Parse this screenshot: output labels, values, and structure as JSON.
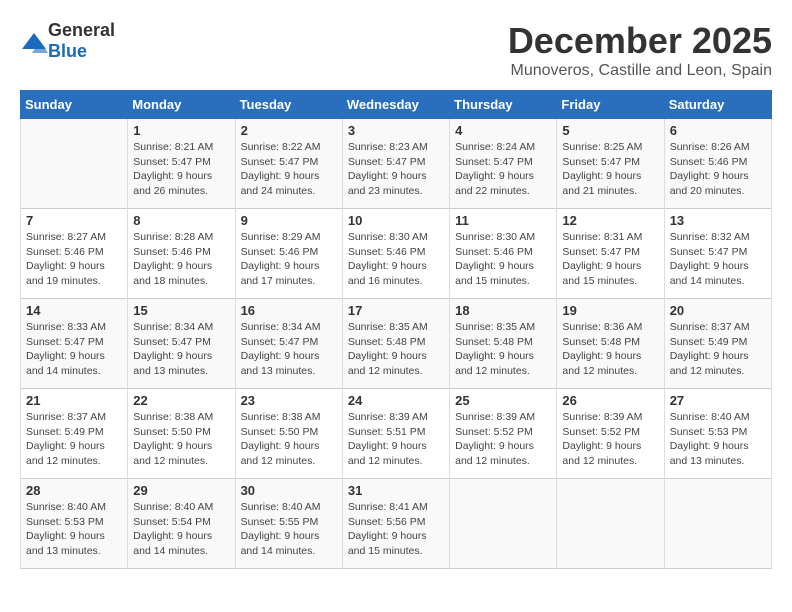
{
  "logo": {
    "general": "General",
    "blue": "Blue"
  },
  "title": "December 2025",
  "subtitle": "Munoveros, Castille and Leon, Spain",
  "days_of_week": [
    "Sunday",
    "Monday",
    "Tuesday",
    "Wednesday",
    "Thursday",
    "Friday",
    "Saturday"
  ],
  "weeks": [
    [
      {
        "num": "",
        "sunrise": "",
        "sunset": "",
        "daylight": ""
      },
      {
        "num": "1",
        "sunrise": "Sunrise: 8:21 AM",
        "sunset": "Sunset: 5:47 PM",
        "daylight": "Daylight: 9 hours and 26 minutes."
      },
      {
        "num": "2",
        "sunrise": "Sunrise: 8:22 AM",
        "sunset": "Sunset: 5:47 PM",
        "daylight": "Daylight: 9 hours and 24 minutes."
      },
      {
        "num": "3",
        "sunrise": "Sunrise: 8:23 AM",
        "sunset": "Sunset: 5:47 PM",
        "daylight": "Daylight: 9 hours and 23 minutes."
      },
      {
        "num": "4",
        "sunrise": "Sunrise: 8:24 AM",
        "sunset": "Sunset: 5:47 PM",
        "daylight": "Daylight: 9 hours and 22 minutes."
      },
      {
        "num": "5",
        "sunrise": "Sunrise: 8:25 AM",
        "sunset": "Sunset: 5:47 PM",
        "daylight": "Daylight: 9 hours and 21 minutes."
      },
      {
        "num": "6",
        "sunrise": "Sunrise: 8:26 AM",
        "sunset": "Sunset: 5:46 PM",
        "daylight": "Daylight: 9 hours and 20 minutes."
      }
    ],
    [
      {
        "num": "7",
        "sunrise": "Sunrise: 8:27 AM",
        "sunset": "Sunset: 5:46 PM",
        "daylight": "Daylight: 9 hours and 19 minutes."
      },
      {
        "num": "8",
        "sunrise": "Sunrise: 8:28 AM",
        "sunset": "Sunset: 5:46 PM",
        "daylight": "Daylight: 9 hours and 18 minutes."
      },
      {
        "num": "9",
        "sunrise": "Sunrise: 8:29 AM",
        "sunset": "Sunset: 5:46 PM",
        "daylight": "Daylight: 9 hours and 17 minutes."
      },
      {
        "num": "10",
        "sunrise": "Sunrise: 8:30 AM",
        "sunset": "Sunset: 5:46 PM",
        "daylight": "Daylight: 9 hours and 16 minutes."
      },
      {
        "num": "11",
        "sunrise": "Sunrise: 8:30 AM",
        "sunset": "Sunset: 5:46 PM",
        "daylight": "Daylight: 9 hours and 15 minutes."
      },
      {
        "num": "12",
        "sunrise": "Sunrise: 8:31 AM",
        "sunset": "Sunset: 5:47 PM",
        "daylight": "Daylight: 9 hours and 15 minutes."
      },
      {
        "num": "13",
        "sunrise": "Sunrise: 8:32 AM",
        "sunset": "Sunset: 5:47 PM",
        "daylight": "Daylight: 9 hours and 14 minutes."
      }
    ],
    [
      {
        "num": "14",
        "sunrise": "Sunrise: 8:33 AM",
        "sunset": "Sunset: 5:47 PM",
        "daylight": "Daylight: 9 hours and 14 minutes."
      },
      {
        "num": "15",
        "sunrise": "Sunrise: 8:34 AM",
        "sunset": "Sunset: 5:47 PM",
        "daylight": "Daylight: 9 hours and 13 minutes."
      },
      {
        "num": "16",
        "sunrise": "Sunrise: 8:34 AM",
        "sunset": "Sunset: 5:47 PM",
        "daylight": "Daylight: 9 hours and 13 minutes."
      },
      {
        "num": "17",
        "sunrise": "Sunrise: 8:35 AM",
        "sunset": "Sunset: 5:48 PM",
        "daylight": "Daylight: 9 hours and 12 minutes."
      },
      {
        "num": "18",
        "sunrise": "Sunrise: 8:35 AM",
        "sunset": "Sunset: 5:48 PM",
        "daylight": "Daylight: 9 hours and 12 minutes."
      },
      {
        "num": "19",
        "sunrise": "Sunrise: 8:36 AM",
        "sunset": "Sunset: 5:48 PM",
        "daylight": "Daylight: 9 hours and 12 minutes."
      },
      {
        "num": "20",
        "sunrise": "Sunrise: 8:37 AM",
        "sunset": "Sunset: 5:49 PM",
        "daylight": "Daylight: 9 hours and 12 minutes."
      }
    ],
    [
      {
        "num": "21",
        "sunrise": "Sunrise: 8:37 AM",
        "sunset": "Sunset: 5:49 PM",
        "daylight": "Daylight: 9 hours and 12 minutes."
      },
      {
        "num": "22",
        "sunrise": "Sunrise: 8:38 AM",
        "sunset": "Sunset: 5:50 PM",
        "daylight": "Daylight: 9 hours and 12 minutes."
      },
      {
        "num": "23",
        "sunrise": "Sunrise: 8:38 AM",
        "sunset": "Sunset: 5:50 PM",
        "daylight": "Daylight: 9 hours and 12 minutes."
      },
      {
        "num": "24",
        "sunrise": "Sunrise: 8:39 AM",
        "sunset": "Sunset: 5:51 PM",
        "daylight": "Daylight: 9 hours and 12 minutes."
      },
      {
        "num": "25",
        "sunrise": "Sunrise: 8:39 AM",
        "sunset": "Sunset: 5:52 PM",
        "daylight": "Daylight: 9 hours and 12 minutes."
      },
      {
        "num": "26",
        "sunrise": "Sunrise: 8:39 AM",
        "sunset": "Sunset: 5:52 PM",
        "daylight": "Daylight: 9 hours and 12 minutes."
      },
      {
        "num": "27",
        "sunrise": "Sunrise: 8:40 AM",
        "sunset": "Sunset: 5:53 PM",
        "daylight": "Daylight: 9 hours and 13 minutes."
      }
    ],
    [
      {
        "num": "28",
        "sunrise": "Sunrise: 8:40 AM",
        "sunset": "Sunset: 5:53 PM",
        "daylight": "Daylight: 9 hours and 13 minutes."
      },
      {
        "num": "29",
        "sunrise": "Sunrise: 8:40 AM",
        "sunset": "Sunset: 5:54 PM",
        "daylight": "Daylight: 9 hours and 14 minutes."
      },
      {
        "num": "30",
        "sunrise": "Sunrise: 8:40 AM",
        "sunset": "Sunset: 5:55 PM",
        "daylight": "Daylight: 9 hours and 14 minutes."
      },
      {
        "num": "31",
        "sunrise": "Sunrise: 8:41 AM",
        "sunset": "Sunset: 5:56 PM",
        "daylight": "Daylight: 9 hours and 15 minutes."
      },
      {
        "num": "",
        "sunrise": "",
        "sunset": "",
        "daylight": ""
      },
      {
        "num": "",
        "sunrise": "",
        "sunset": "",
        "daylight": ""
      },
      {
        "num": "",
        "sunrise": "",
        "sunset": "",
        "daylight": ""
      }
    ]
  ]
}
